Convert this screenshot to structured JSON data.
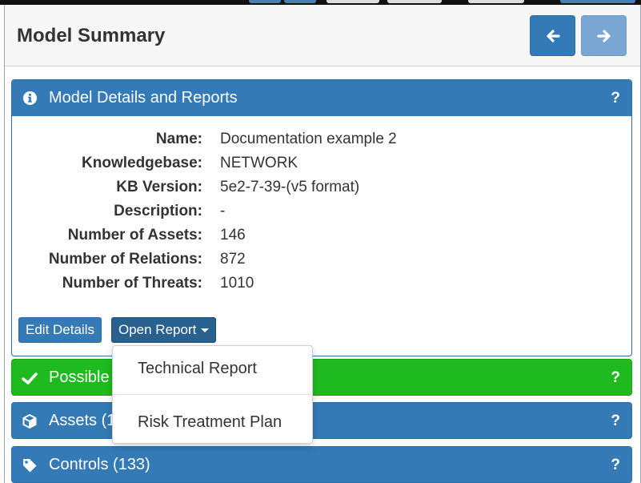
{
  "colors": {
    "primary": "#337ab7",
    "primary_dark": "#286090",
    "success": "#1fba1f",
    "disabled": "#7aa6d3"
  },
  "header": {
    "title": "Model Summary",
    "prev_icon": "arrow-left-icon",
    "next_icon": "arrow-right-icon"
  },
  "details_panel": {
    "title": "Model Details and Reports",
    "icon": "info-circle-icon",
    "help": "?",
    "fields": [
      {
        "label": "Name:",
        "value": "Documentation example 2"
      },
      {
        "label": "Knowledgebase:",
        "value": "NETWORK"
      },
      {
        "label": "KB Version:",
        "value": "5e2-7-39-(v5 format)"
      },
      {
        "label": "Description:",
        "value": "-"
      },
      {
        "label": "Number of Assets:",
        "value": "146"
      },
      {
        "label": "Number of Relations:",
        "value": "872"
      },
      {
        "label": "Number of Threats:",
        "value": "1010"
      }
    ],
    "edit_button": "Edit Details",
    "open_report_button": "Open Report"
  },
  "report_menu": {
    "items": [
      "Technical Report",
      "Risk Treatment Plan"
    ]
  },
  "threats_panel": {
    "title": "Possible",
    "icon": "check-icon",
    "help": "?"
  },
  "assets_panel": {
    "title": "Assets (1",
    "icon": "cube-icon",
    "help": "?"
  },
  "controls_panel": {
    "title": "Controls (133)",
    "icon": "tag-icon",
    "help": "?"
  }
}
